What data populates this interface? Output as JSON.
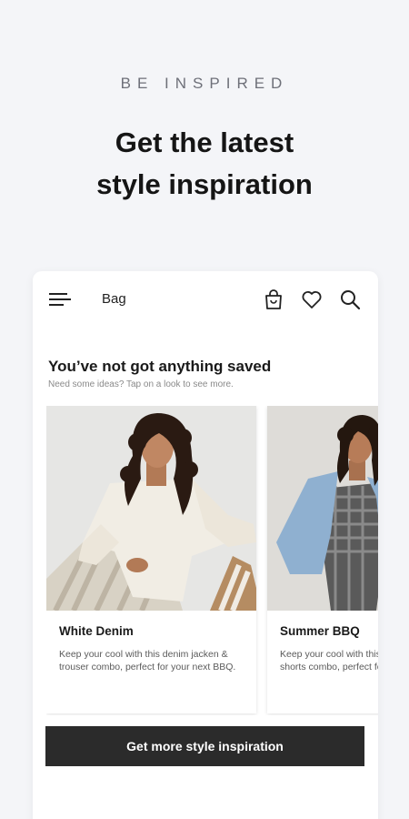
{
  "hero": {
    "eyebrow": "BE INSPIRED",
    "headline_line1": "Get the latest",
    "headline_line2": "style inspiration"
  },
  "app": {
    "topbar": {
      "title": "Bag",
      "icons": [
        "menu-icon",
        "shopping-bag-icon",
        "heart-icon",
        "search-icon"
      ]
    },
    "empty_state": {
      "title": "You’ve not got anything saved",
      "subtitle": "Need some ideas? Tap on a look to see more."
    },
    "looks": [
      {
        "title": "White Denim",
        "description": "Keep your cool with this denim jacken & trouser combo, perfect for your next BBQ."
      },
      {
        "title": "Summer BBQ",
        "description": "Keep your cool with this denim jacket & shorts combo, perfect for your next BBQ."
      }
    ],
    "cta_label": "Get more style inspiration"
  },
  "colors": {
    "page_bg": "#f4f5f8",
    "card_bg": "#ffffff",
    "cta_bg": "#2b2b2b",
    "cta_text": "#ffffff"
  }
}
